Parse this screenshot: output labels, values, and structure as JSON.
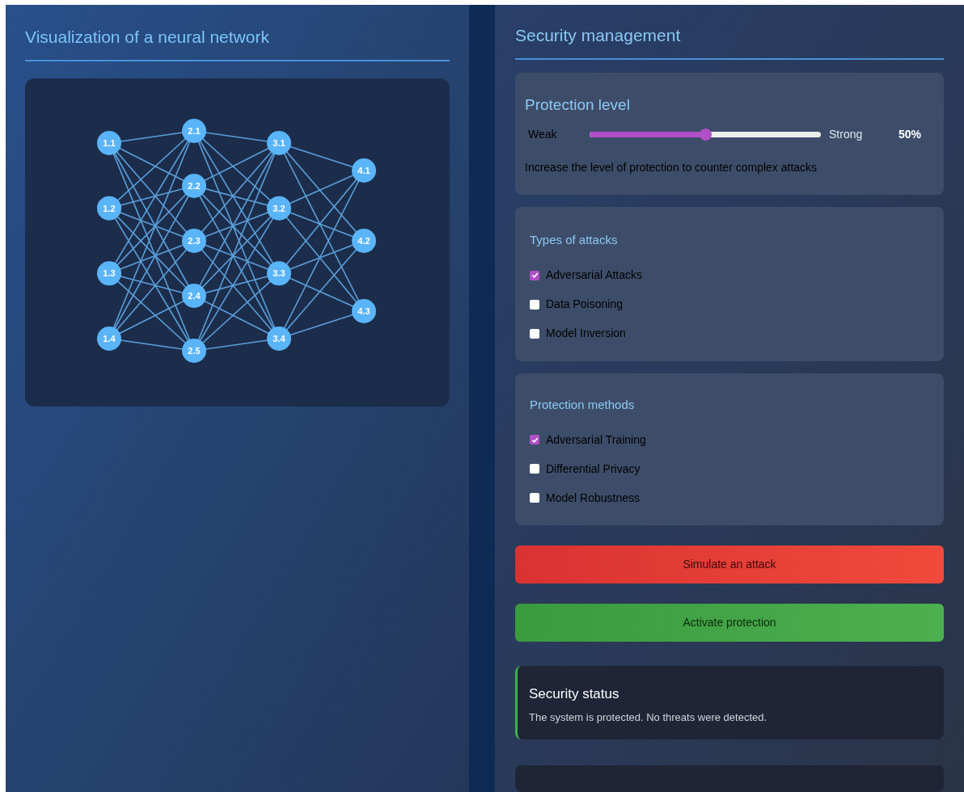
{
  "network_panel": {
    "title": "Visualization of a neural network",
    "layers": [
      [
        "1.1",
        "1.2",
        "1.3",
        "1.4"
      ],
      [
        "2.1",
        "2.2",
        "2.3",
        "2.4",
        "2.5"
      ],
      [
        "3.1",
        "3.2",
        "3.3",
        "3.4"
      ],
      [
        "4.1",
        "4.2",
        "4.3"
      ]
    ]
  },
  "security_panel": {
    "title": "Security management",
    "protection_level": {
      "title": "Protection level",
      "min_label": "Weak",
      "max_label": "Strong",
      "level": 0.5,
      "reading": "50%",
      "hint": "Increase the level of protection to counter complex attacks"
    },
    "attack_types": {
      "title": "Types of attacks",
      "items": [
        {
          "label": "Adversarial Attacks",
          "checked": true
        },
        {
          "label": "Data Poisoning",
          "checked": false
        },
        {
          "label": "Model Inversion",
          "checked": false
        }
      ]
    },
    "protection_methods": {
      "title": "Protection methods",
      "items": [
        {
          "label": "Adversarial Training",
          "checked": true
        },
        {
          "label": "Differential Privacy",
          "checked": false
        },
        {
          "label": "Model Robustness",
          "checked": false
        }
      ]
    },
    "buttons": [
      {
        "label": "Simulate an attack",
        "kind": "danger"
      },
      {
        "label": "Activate protection",
        "kind": "success"
      }
    ],
    "status": {
      "title": "Security status",
      "message": "The system is protected. No threats were detected."
    }
  }
}
